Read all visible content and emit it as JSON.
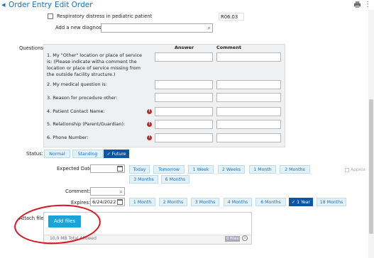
{
  "header": {
    "back_icon": "back-arrow-icon",
    "title": "Order Entry",
    "separator": "›",
    "subtitle": "Edit Order",
    "print_icon": "printer-icon",
    "more_icon": "more-icon"
  },
  "diagnosis": {
    "item_label": "Respiratory distress in pediatric patient",
    "item_code": "R06.03",
    "add_label": "Add a new diagnosis:",
    "add_value": ""
  },
  "questions": {
    "label": "Questions:",
    "answer_header": "Answer",
    "comment_header": "Comment",
    "items": [
      {
        "text": "1. My \"Other\" location or place of service is: (Please indicate witha comment the location or place of service missing from the outside facility structure.)",
        "required": false
      },
      {
        "text": "2. My medical question is:",
        "required": false
      },
      {
        "text": "3. Reason for procedure other:",
        "required": false
      },
      {
        "text": "4. Patient Contact Name:",
        "required": true
      },
      {
        "text": "5. Relationship (Parent/Guardian):",
        "required": true
      },
      {
        "text": "6. Phone Number:",
        "required": true
      }
    ]
  },
  "status": {
    "label": "Status:",
    "options": [
      "Normal",
      "Standing",
      "✓ Future"
    ],
    "selected": "Future"
  },
  "expected_date": {
    "label": "Expected Date:",
    "value": "",
    "shortcuts": [
      "Today",
      "Tomorrow",
      "1 Week",
      "2 Weeks",
      "1 Month",
      "2 Months",
      "3 Months",
      "6 Months"
    ],
    "approx_label": "Approx"
  },
  "comment": {
    "label": "Comment:",
    "value": ""
  },
  "expires": {
    "label": "Expires:",
    "value": "6/24/2022",
    "shortcuts": [
      "1 Month",
      "2 Months",
      "3 Months",
      "4 Months",
      "6 Months",
      "✓ 1 Year",
      "18 Months"
    ],
    "selected": "1 Year"
  },
  "attach": {
    "label": "Attach files:",
    "button": "Add files",
    "note": "10.0 MB Total Allowed",
    "count_badge": "0 Files",
    "info_icon": "info-icon"
  },
  "colors": {
    "link_blue": "#1d6fb8",
    "selected_chip": "#0b57a4",
    "chip_bg": "#e3f1f8",
    "add_files_button": "#1aa3d6",
    "required_red": "#c62828",
    "annotation_red": "#d8151e",
    "question_panel": "#eef0f2"
  }
}
